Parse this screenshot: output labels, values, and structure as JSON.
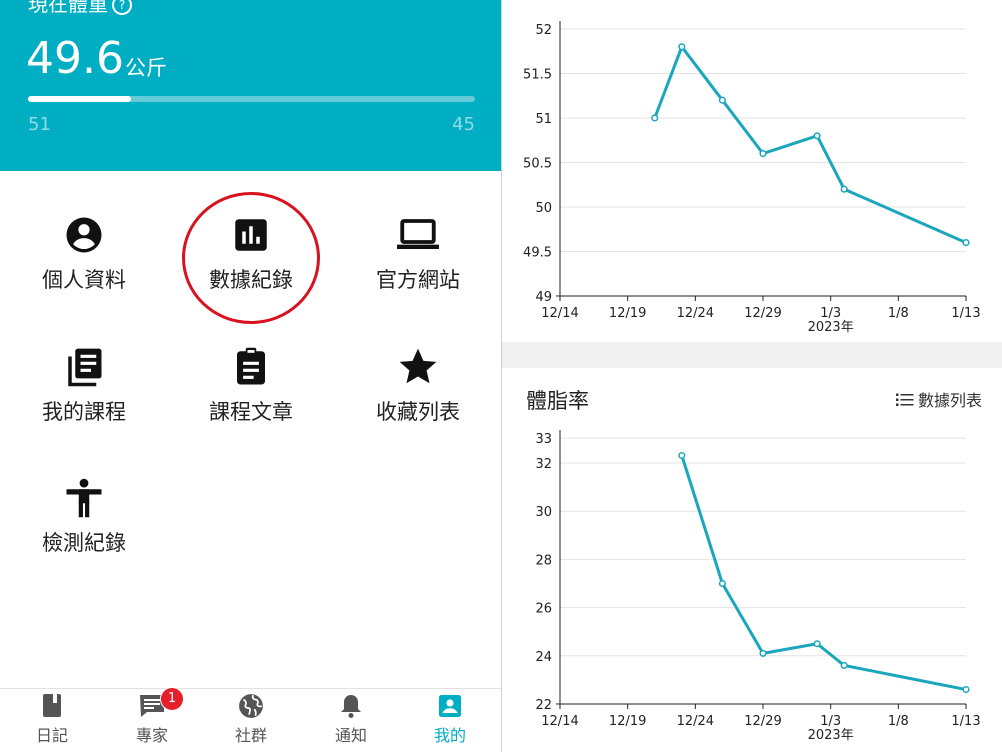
{
  "header": {
    "title": "現在體重",
    "current_weight": "49.6",
    "unit": "公斤",
    "start_value": "51",
    "goal_value": "45",
    "progress": 0.23
  },
  "menu": [
    {
      "label": "個人資料",
      "icon": "account-circle-icon"
    },
    {
      "label": "數據紀錄",
      "icon": "bar-chart-icon"
    },
    {
      "label": "官方網站",
      "icon": "laptop-icon"
    },
    {
      "label": "我的課程",
      "icon": "library-books-icon"
    },
    {
      "label": "課程文章",
      "icon": "clipboard-icon"
    },
    {
      "label": "收藏列表",
      "icon": "star-icon"
    },
    {
      "label": "檢測紀錄",
      "icon": "person-icon"
    }
  ],
  "tabs": [
    {
      "label": "日記",
      "icon": "book-icon"
    },
    {
      "label": "專家",
      "icon": "chat-icon",
      "badge": "1"
    },
    {
      "label": "社群",
      "icon": "globe-icon"
    },
    {
      "label": "通知",
      "icon": "bell-icon"
    },
    {
      "label": "我的",
      "icon": "profile-icon",
      "active": true
    }
  ],
  "body_fat_section": {
    "title": "體脂率",
    "list_link": "數據列表"
  },
  "colors": {
    "accent": "#00aec3",
    "line": "#1aa6bd",
    "highlight": "#d9121f"
  },
  "chart_data": [
    {
      "type": "line",
      "title": "",
      "x_ticks": [
        "12/14",
        "12/19",
        "12/24",
        "12/29",
        "1/3",
        "1/8",
        "1/13"
      ],
      "x_tick_days": [
        0,
        5,
        10,
        15,
        20,
        25,
        30
      ],
      "x_sublabel": "2023年",
      "y_ticks": [
        "52",
        "51.5",
        "51",
        "50.5",
        "50",
        "49.5",
        "49"
      ],
      "ylim": [
        49,
        52
      ],
      "grid": true,
      "series": [
        {
          "x_days": [
            7,
            9,
            12,
            15,
            19,
            21,
            30
          ],
          "values": [
            51.0,
            51.8,
            51.2,
            50.6,
            50.8,
            50.2,
            49.6
          ]
        }
      ]
    },
    {
      "type": "line",
      "title": "體脂率",
      "x_ticks": [
        "12/14",
        "12/19",
        "12/24",
        "12/29",
        "1/3",
        "1/8",
        "1/13"
      ],
      "x_tick_days": [
        0,
        5,
        10,
        15,
        20,
        25,
        30
      ],
      "x_sublabel": "2023年",
      "y_ticks": [
        "33",
        "32",
        "30",
        "28",
        "26",
        "24",
        "22"
      ],
      "ylim": [
        22,
        33
      ],
      "grid": true,
      "series": [
        {
          "x_days": [
            9,
            12,
            15,
            19,
            21,
            30
          ],
          "values": [
            32.3,
            27.0,
            24.1,
            24.5,
            23.6,
            22.6
          ]
        }
      ]
    }
  ]
}
